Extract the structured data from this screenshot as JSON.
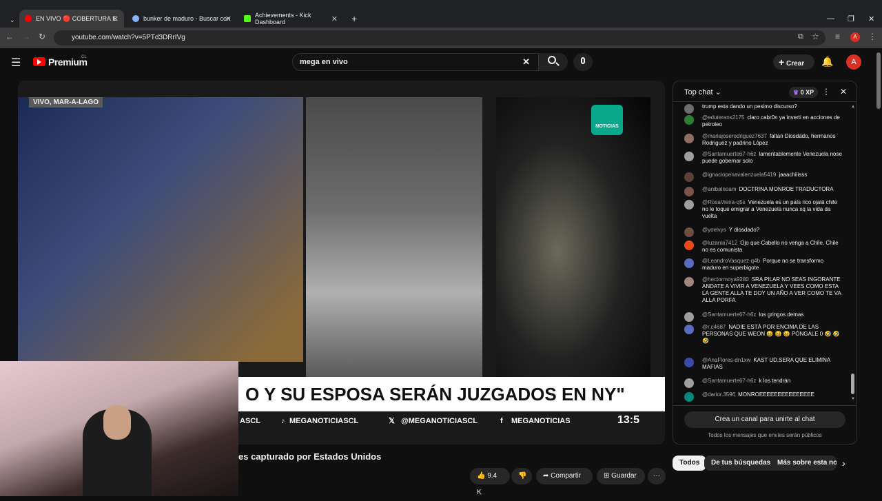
{
  "browser": {
    "tabs": [
      {
        "label": "EN VIVO 🔴 COBERTURA E",
        "active": true
      },
      {
        "label": "bunker de maduro - Buscar con",
        "active": false
      },
      {
        "label": "Achievements - Kick Dashboard",
        "active": false
      }
    ],
    "url": "youtube.com/watch?v=5PTd3DRrIVg",
    "profile_initial": "A"
  },
  "youtube": {
    "logo_text": "Premium",
    "region": "CL",
    "search_value": "mega en vivo",
    "create_label": "Crear",
    "avatar_initial": "A"
  },
  "video": {
    "live_tag": "VIVO, MAR-A-LAGO",
    "channel_logo_text": "NOTICIAS",
    "ticker_text": "O Y SU ESPOSA SERÁN JUZGADOS EN NY\"",
    "social_items": [
      "ASCL",
      "MEGANOTICIASCL",
      "@MEGANOTICIASCL",
      "MEGANOTICIAS"
    ],
    "clock": "13:5",
    "title": "es capturado por Estados Unidos",
    "likes": "9.4 K",
    "share_label": "Compartir",
    "save_label": "Guardar"
  },
  "chat": {
    "title": "Top chat",
    "xp": "0 XP",
    "messages": [
      {
        "user": "",
        "text": "trump esta dando un pesimo discurso?",
        "avatar_color": "#6b6b6b"
      },
      {
        "user": "@eduterans2175",
        "text": "claro cabr0n ya inverti en acciones de petroleo",
        "avatar_color": "#2e7d32"
      },
      {
        "user": "@mariajoserodriguez7637",
        "text": "faltan Diosdado, hermanos Rodriguez y padrino López",
        "avatar_color": "#8d6e63"
      },
      {
        "user": "@Santamuerte67-h6z",
        "text": "lamentablemente Venezuela nose puede gobernar solo",
        "avatar_color": "#9e9e9e"
      },
      {
        "user": "@ignaciopenavalenzuela5419",
        "text": "jaaachiiisss",
        "avatar_color": "#5d4037"
      },
      {
        "user": "@anibalnoam",
        "text": "DOCTRINA MONROE TRADUCTORA",
        "avatar_color": "#795548"
      },
      {
        "user": "@RosaVieira-q5s",
        "text": "Venezuela es un país rico ojalá chile no le toque emigrar a Venezuela nunca xq la vida da vuelta",
        "avatar_color": "#9e9e9e"
      },
      {
        "user": "@yoelvys",
        "text": "Y diosdado?",
        "avatar_color": "#6d4c41"
      },
      {
        "user": "@luzania7412",
        "text": "Ojo que Cabello no venga a Chile, Chile no es comunista",
        "avatar_color": "#e64a19"
      },
      {
        "user": "@LeandroVasquez-q4b",
        "text": "Porque no se transformo maduro en superbigote",
        "avatar_color": "#5c6bc0"
      },
      {
        "user": "@hectormoya9280",
        "text": "SRA PILAR NO SEAS INGORANTE ANDATE A VIVIR A VENEZUELA Y VEES COMO ESTA LA GENTE ALLA TE DOY UN AÑO A VER COMO TE VA ALLA PORFA",
        "avatar_color": "#a1887f"
      },
      {
        "user": "@Santamuerte67-h6z",
        "text": "los gringos demas",
        "avatar_color": "#9e9e9e"
      },
      {
        "user": "@r.c4687",
        "text": "NADIE ESTÁ POR ENCIMA DE LAS PERSONAS QUE WEON 😆 😆 😆 PÓNGALE 0 🤣 🤣 🤣",
        "avatar_color": "#5c6bc0"
      },
      {
        "user": "@AnaFlores-dn1xw",
        "text": "KAST UD.SERA QUE ELIMINA MAFIAS",
        "avatar_color": "#3949ab"
      },
      {
        "user": "@Santamuerte67-h6z",
        "text": "k los tendrán",
        "avatar_color": "#9e9e9e"
      },
      {
        "user": "@darior.3596",
        "text": "MONROEEEEEEEEEEEEEEE",
        "avatar_color": "#00897b"
      }
    ],
    "create_channel_label": "Crea un canal para unirte al chat",
    "public_notice": "Todos los mensajes que envíes serán públicos"
  },
  "chips": [
    "Todos",
    "De tus búsquedas",
    "Más sobre esta not"
  ]
}
